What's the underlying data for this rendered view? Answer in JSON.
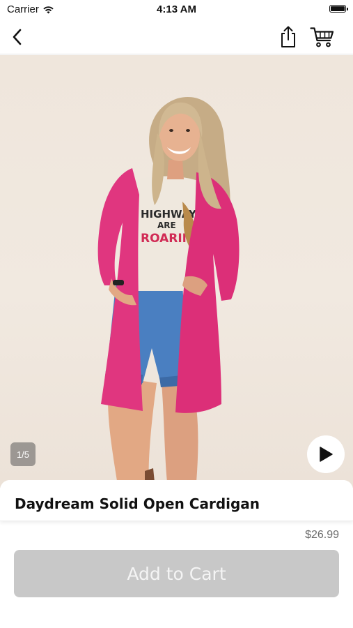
{
  "status_bar": {
    "carrier": "Carrier",
    "time": "4:13 AM"
  },
  "nav": {
    "icons": [
      "back-chevron-icon",
      "share-icon",
      "cart-icon"
    ]
  },
  "gallery": {
    "counter": "1/5",
    "shirt_text_line1": "HIGHWAYS",
    "shirt_text_line2": "ARE",
    "shirt_text_line3": "ROARING",
    "play_icon": "play-icon"
  },
  "product": {
    "title": "Daydream Solid Open Cardigan",
    "price": "$26.99",
    "add_to_cart_label": "Add to Cart"
  },
  "colors": {
    "button_disabled": "#c8c8c8",
    "cardigan": "#e0367f",
    "denim": "#4a7fc1"
  }
}
